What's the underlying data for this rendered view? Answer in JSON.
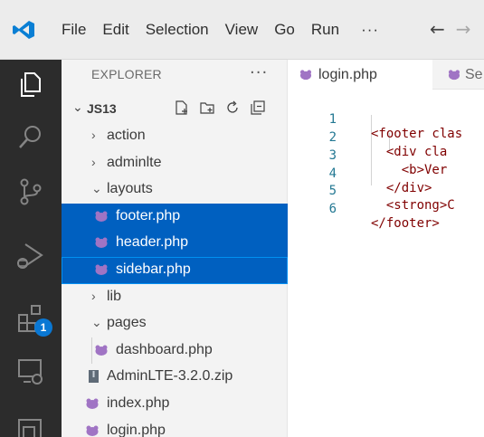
{
  "menu": {
    "items": [
      "File",
      "Edit",
      "Selection",
      "View",
      "Go",
      "Run"
    ],
    "more": "···",
    "back_arrow": "←",
    "forward_arrow": "→"
  },
  "activity_bar": {
    "icons": [
      "explorer-icon",
      "search-icon",
      "source-control-icon",
      "run-debug-icon",
      "extensions-icon",
      "remote-explorer-icon",
      "remote-icon"
    ],
    "extensions_badge": "1"
  },
  "explorer": {
    "header": "EXPLORER",
    "more": "···",
    "workspace": "JS13",
    "items": [
      {
        "label": "action",
        "type": "folder",
        "expanded": false,
        "depth": 1
      },
      {
        "label": "adminlte",
        "type": "folder",
        "expanded": false,
        "depth": 1
      },
      {
        "label": "layouts",
        "type": "folder",
        "expanded": true,
        "depth": 1
      },
      {
        "label": "footer.php",
        "type": "php",
        "depth": 2,
        "selected": true
      },
      {
        "label": "header.php",
        "type": "php",
        "depth": 2,
        "selected": true
      },
      {
        "label": "sidebar.php",
        "type": "php",
        "depth": 2,
        "selected": true,
        "focused": true
      },
      {
        "label": "lib",
        "type": "folder",
        "expanded": false,
        "depth": 1
      },
      {
        "label": "pages",
        "type": "folder",
        "expanded": true,
        "depth": 1
      },
      {
        "label": "dashboard.php",
        "type": "php",
        "depth": 2
      },
      {
        "label": "AdminLTE-3.2.0.zip",
        "type": "zip",
        "depth": 1
      },
      {
        "label": "index.php",
        "type": "php",
        "depth": 1
      },
      {
        "label": "login.php",
        "type": "php",
        "depth": 1
      }
    ]
  },
  "tabs": [
    {
      "label": "login.php",
      "active": true
    },
    {
      "label": "Se",
      "active": false
    }
  ],
  "editor": {
    "lines": [
      {
        "num": "1",
        "text": "<footer clas"
      },
      {
        "num": "2",
        "text": "  <div cla"
      },
      {
        "num": "3",
        "text": "    <b>Ver"
      },
      {
        "num": "4",
        "text": "  </div>"
      },
      {
        "num": "5",
        "text": "  <strong>C"
      },
      {
        "num": "6",
        "text": "</footer>"
      }
    ]
  },
  "colors": {
    "accent": "#0060c0",
    "php_icon": "#a074c4",
    "line_number": "#237893",
    "tag": "#800000"
  }
}
